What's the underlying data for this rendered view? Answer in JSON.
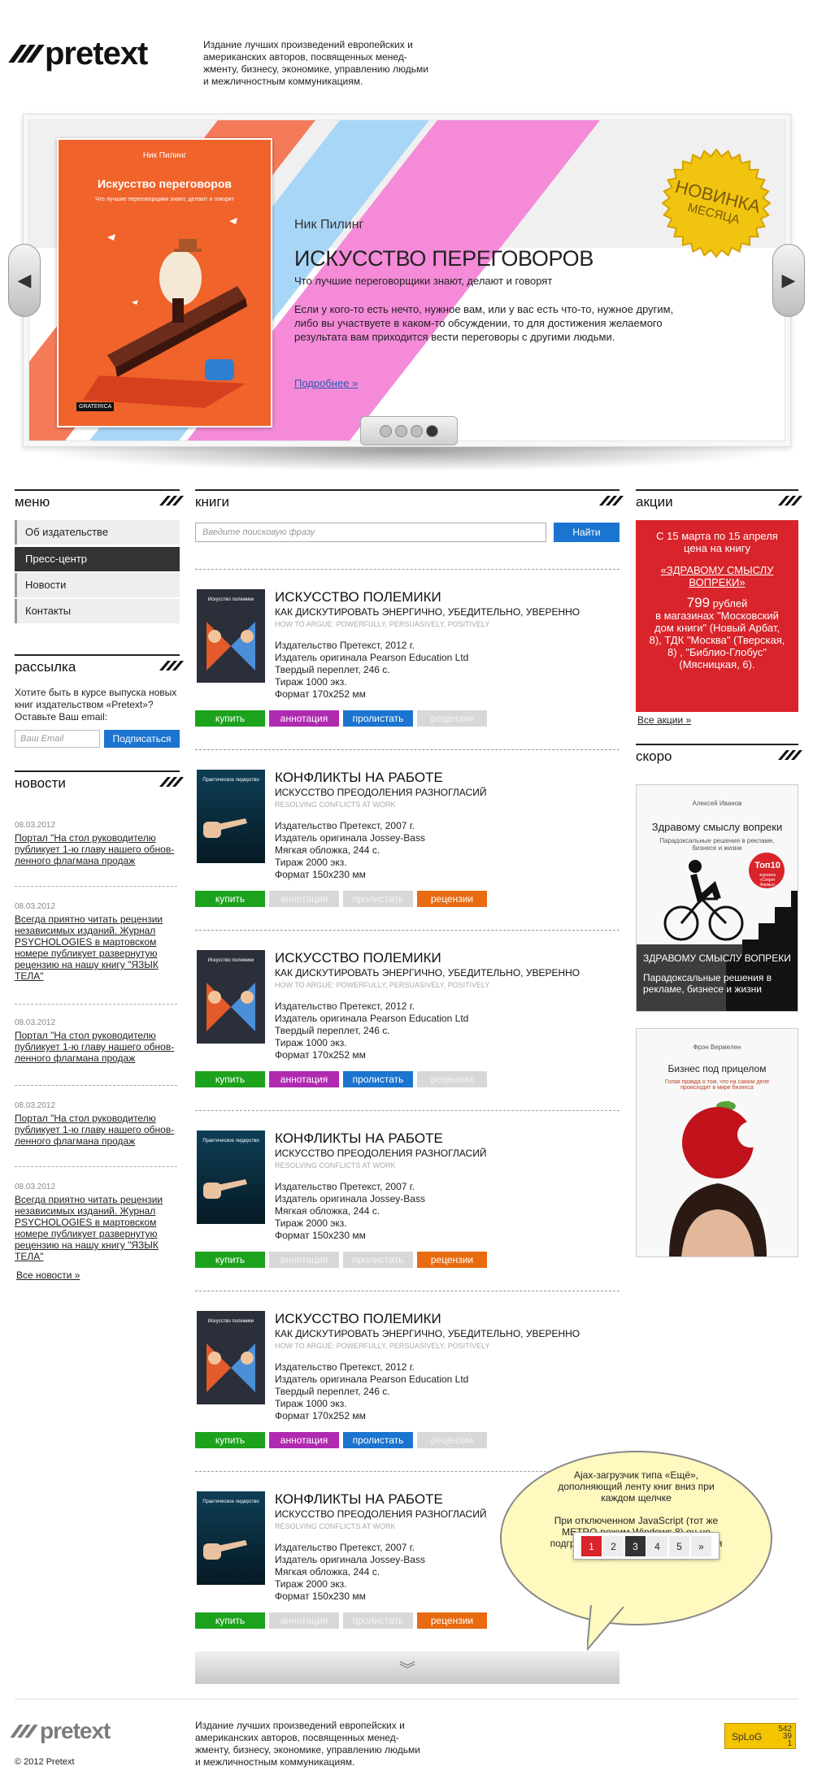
{
  "header": {
    "logo_text": "pretext",
    "tagline": "Издание лучших произведений европейских и американских авторов, посвященных менед-жменту, бизнесу, экономике, управлению людьми и межличностным коммуникациям."
  },
  "slider": {
    "cover": {
      "author": "Ник Пилинг",
      "title": "Искусство переговоров",
      "subtitle": "Что лучшие переговорщики знают, делают и говорят",
      "brand": "GRATERICA"
    },
    "author": "Ник Пилинг",
    "title": "ИСКУССТВО ПЕРЕГОВОРОВ",
    "subtitle": "Что лучшие переговорщики знают, делают и говорят",
    "description": "Если у кого-то есть нечто, нужное вам, или у вас есть что-то, нужное другим, либо вы участвуете в каком-то обсуждении, то для достижения желаемого результата вам приходится вести переговоры с другими людьми.",
    "more_link": "Подробнее »",
    "badge_line1": "НОВИНКА",
    "badge_line2": "МЕСЯЦА",
    "prev_icon": "arrow-left",
    "next_icon": "arrow-right",
    "dots_total": 4,
    "dots_active": 4
  },
  "left": {
    "menu_title": "меню",
    "menu_items": [
      "Об издательстве",
      "Пресс-центр",
      "Новости",
      "Контакты"
    ],
    "subscribe_title": "рассылка",
    "subscribe_text": "Хотите быть в курсе выпуска новых книг издательством «Pretext»? Оставьте Ваш email:",
    "email_placeholder": "Ваш Email",
    "subscribe_button": "Подписаться",
    "news_title": "новости",
    "news": [
      {
        "date": "08.03.2012",
        "text": "Портал \"На стол руководителю публикует 1-ю главу нашего обнов-ленного флагмана продаж"
      },
      {
        "date": "08.03.2012",
        "text": "Всегда приятно читать рецензии независимых изданий. Журнал PSYCHOLOGIES в мартовском номере публикует развернутую рецензию на нашу книгу \"ЯЗЫК ТЕЛА\""
      },
      {
        "date": "08.03.2012",
        "text": "Портал \"На стол руководителю публикует 1-ю главу нашего обнов-ленного флагмана продаж"
      },
      {
        "date": "08.03.2012",
        "text": "Портал \"На стол руководителю публикует 1-ю главу нашего обнов-ленного флагмана продаж"
      },
      {
        "date": "08.03.2012",
        "text": "Всегда приятно читать рецензии независимых изданий. Журнал PSYCHOLOGIES в мартовском номере публикует развернутую рецензию на нашу книгу \"ЯЗЫК ТЕЛА\""
      }
    ],
    "all_news": "Все новости »"
  },
  "center": {
    "title": "книги",
    "search_placeholder": "Введите поисковую фразу",
    "search_button": "Найти",
    "buttons": [
      "купить",
      "аннотация",
      "пролистать",
      "рецензии"
    ],
    "books": [
      {
        "title": "ИСКУССТВО ПОЛЕМИКИ",
        "subtitle": "КАК ДИСКУТИРОВАТЬ ЭНЕРГИЧНО, УБЕДИТЕЛЬНО, УВЕРЕННО",
        "english": "HOW TO ARGUE: POWERFULLY, PERSUASIVELY, POSITIVELY",
        "publisher": "Издательство Претекст, 2012 г.",
        "orig": "Издатель оригинала Pearson Education Ltd",
        "binding": "Твердый переплет, 246 с.",
        "print": "Тираж 1000 экз.",
        "format": "Формат 170х252 мм",
        "cover_title": "Искусство полемики",
        "cover": "polemic",
        "active": [
          true,
          true,
          true,
          false
        ]
      },
      {
        "title": "КОНФЛИКТЫ НА РАБОТЕ",
        "subtitle": "ИСКУССТВО ПРЕОДОЛЕНИЯ РАЗНОГЛАСИЙ",
        "english": "RESOLVING CONFLICTS AT WORK",
        "publisher": "Издательство Претекст, 2007 г.",
        "orig": "Издатель оригинала Jossey-Bass",
        "binding": "Мягкая обложка, 244 с.",
        "print": "Тираж 2000 экз.",
        "format": "Формат 150х230 мм",
        "cover_title": "Практическое лидерство",
        "cover": "conflict",
        "active": [
          true,
          false,
          false,
          true
        ]
      },
      {
        "title": "ИСКУССТВО ПОЛЕМИКИ",
        "subtitle": "КАК ДИСКУТИРОВАТЬ ЭНЕРГИЧНО, УБЕДИТЕЛЬНО, УВЕРЕННО",
        "english": "HOW TO ARGUE: POWERFULLY, PERSUASIVELY, POSITIVELY",
        "publisher": "Издательство Претекст, 2012 г.",
        "orig": "Издатель оригинала Pearson Education Ltd",
        "binding": "Твердый переплет, 246 с.",
        "print": "Тираж 1000 экз.",
        "format": "Формат 170х252 мм",
        "cover_title": "Искусство полемики",
        "cover": "polemic",
        "active": [
          true,
          true,
          true,
          false
        ]
      },
      {
        "title": "КОНФЛИКТЫ НА РАБОТЕ",
        "subtitle": "ИСКУССТВО ПРЕОДОЛЕНИЯ РАЗНОГЛАСИЙ",
        "english": "RESOLVING CONFLICTS AT WORK",
        "publisher": "Издательство Претекст, 2007 г.",
        "orig": "Издатель оригинала Jossey-Bass",
        "binding": "Мягкая обложка, 244 с.",
        "print": "Тираж 2000 экз.",
        "format": "Формат 150х230 мм",
        "cover_title": "Практическое лидерство",
        "cover": "conflict",
        "active": [
          true,
          false,
          false,
          true
        ]
      },
      {
        "title": "ИСКУССТВО ПОЛЕМИКИ",
        "subtitle": "КАК ДИСКУТИРОВАТЬ ЭНЕРГИЧНО, УБЕДИТЕЛЬНО, УВЕРЕННО",
        "english": "HOW TO ARGUE: POWERFULLY, PERSUASIVELY, POSITIVELY",
        "publisher": "Издательство Претекст, 2012 г.",
        "orig": "Издатель оригинала Pearson Education Ltd",
        "binding": "Твердый переплет, 246 с.",
        "print": "Тираж 1000 экз.",
        "format": "Формат 170х252 мм",
        "cover_title": "Искусство полемики",
        "cover": "polemic",
        "active": [
          true,
          true,
          true,
          false
        ]
      },
      {
        "title": "КОНФЛИКТЫ НА РАБОТЕ",
        "subtitle": "ИСКУССТВО ПРЕОДОЛЕНИЯ РАЗНОГЛАСИЙ",
        "english": "RESOLVING CONFLICTS AT WORK",
        "publisher": "Издательство Претекст, 2007 г.",
        "orig": "Издатель оригинала Jossey-Bass",
        "binding": "Мягкая обложка, 244 с.",
        "print": "Тираж 2000 экз.",
        "format": "Формат 150х230 мм",
        "cover_title": "Практическое лидерство",
        "cover": "conflict",
        "active": [
          true,
          false,
          false,
          true
        ]
      }
    ],
    "more_icon": "double-chevron-down"
  },
  "right": {
    "promo_title": "акции",
    "promo_text1": "С 15 марта по 15 апреля цена на книгу",
    "promo_link": "«ЗДРАВОМУ СМЫСЛУ ВОПРЕКИ»",
    "promo_price": "799",
    "promo_currency": "рублей",
    "promo_text2": "в магазинах \"Московский дом книги\" (Новый Арбат, 8), ТДК \"Москва\" (Тверская, 8) , \"Библио-Глобус\" (Мясницкая, 6).",
    "all_promos": "Все акции »",
    "soon_title": "скоро",
    "soon1": {
      "author": "Алексей Иванов",
      "title": "Здравому смыслу вопреки",
      "subtitle": "Парадоксальные решения в рекламе, бизнесе и жизни",
      "top10": "Топ10",
      "top10_text": "журнала «Секрет Фирмы»",
      "overlay_title": "ЗДРАВОМУ СМЫСЛУ ВОПРЕКИ",
      "overlay_sub": "Парадоксальные решения в рекламе, бизнесе и жизни"
    },
    "soon2": {
      "author": "Фрэн Вермелен",
      "title": "Бизнес под прицелом",
      "subtitle": "Голая правда о том, что на самом деле происходит в мире бизнеса"
    }
  },
  "tooltip": {
    "text1": "Ajax-загрузчик типа «Ещё», дополняющий ленту книг вниз при каждом щелчке",
    "text2": "При отключенном JavaScript (тот же METRO-режим Windows 8) он не подгружается, и вместо него остаётся стандартный пагинатор:",
    "pages": [
      "1",
      "2",
      "3",
      "4",
      "5",
      "»"
    ],
    "current_page": "1",
    "hover_page": "3"
  },
  "footer": {
    "logo_text": "pretext",
    "tagline": "Издание лучших произведений европейских и американских авторов, посвященных менед-жменту, бизнесу, экономике, управлению людьми и межличностным коммуникациям.",
    "copyright": "© 2012 Pretext",
    "counter_label": "SpLoG",
    "counter_values": [
      "542",
      "39",
      "1"
    ]
  },
  "colors": {
    "accent_blue": "#1b74cf",
    "buy_green": "#1da21d",
    "annotation_purple": "#b02ab0",
    "review_orange": "#e86b12",
    "promo_red": "#d8242a"
  }
}
